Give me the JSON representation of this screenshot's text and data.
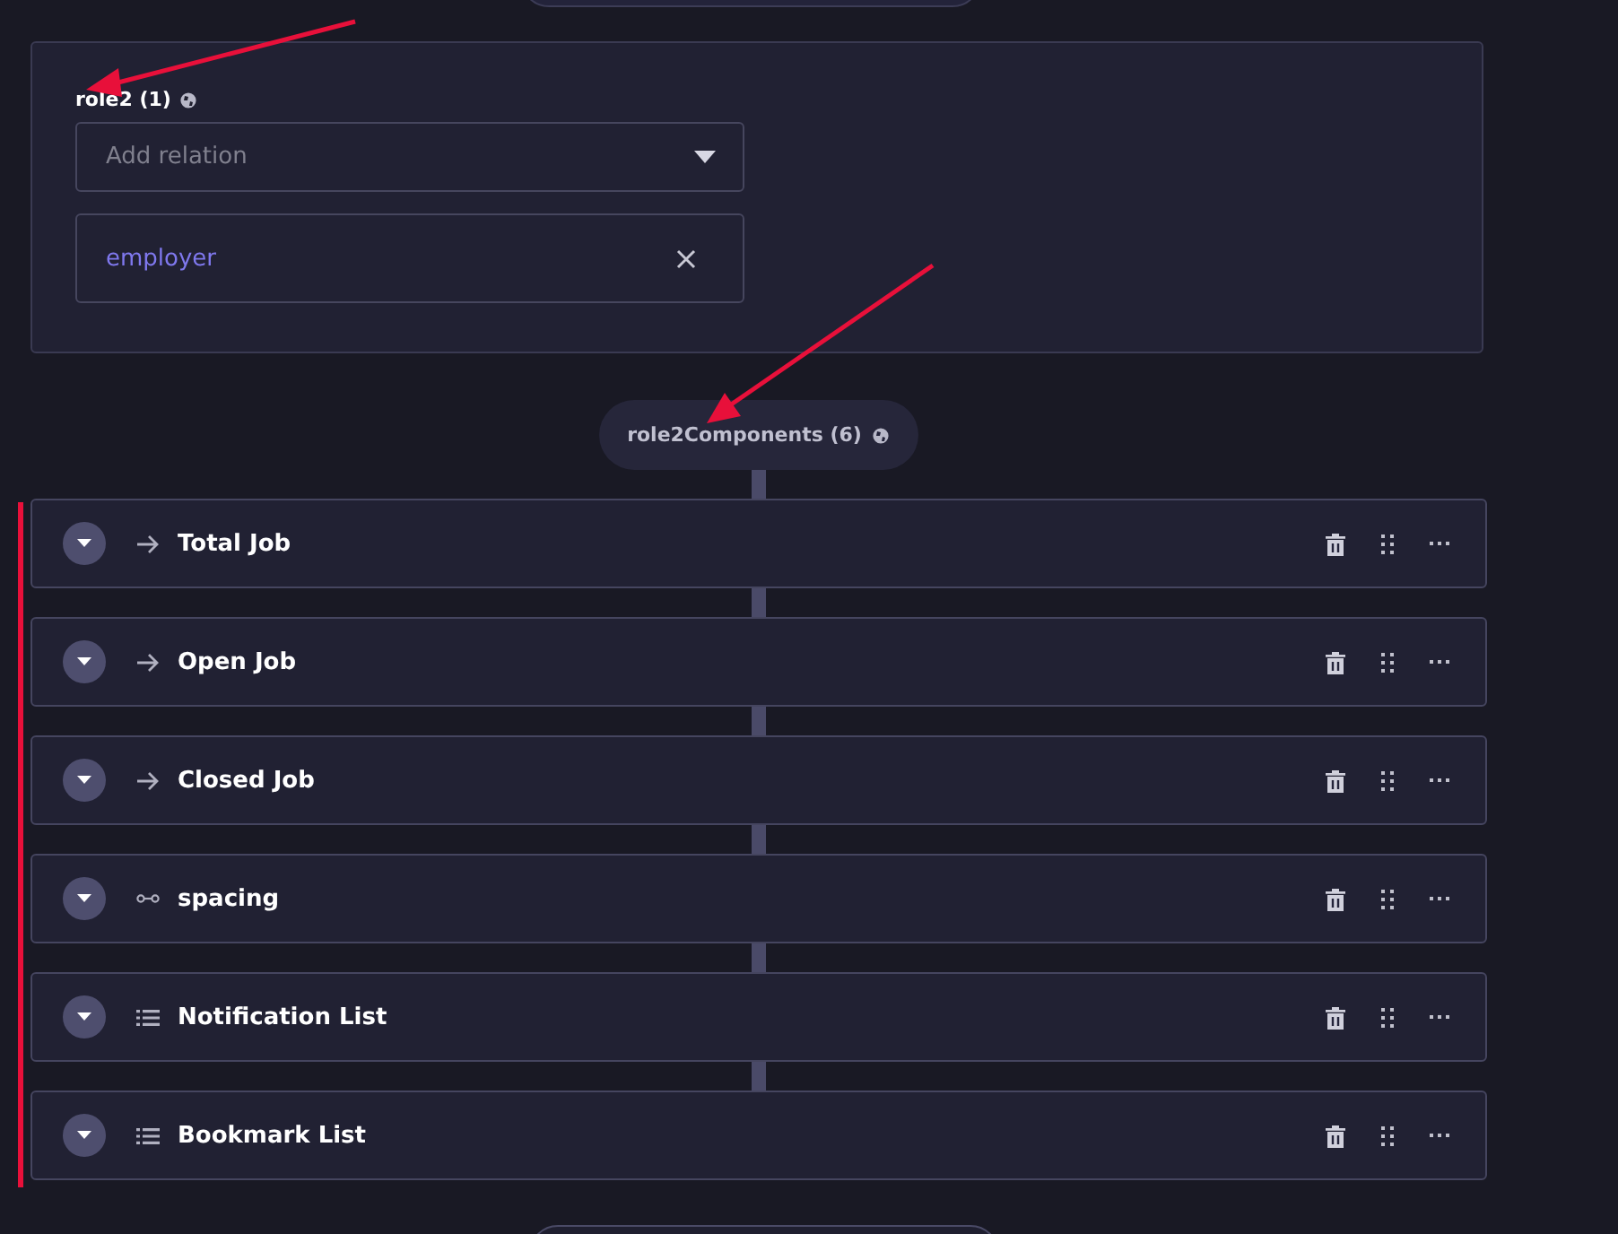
{
  "relation_card": {
    "label": "role2 (1)",
    "dropdown": {
      "placeholder": "Add relation"
    },
    "tags": [
      "employer"
    ]
  },
  "group": {
    "label": "role2Components (6)"
  },
  "components": [
    {
      "label": "Total Job",
      "kind": "arrow"
    },
    {
      "label": "Open Job",
      "kind": "arrow"
    },
    {
      "label": "Closed Job",
      "kind": "arrow"
    },
    {
      "label": "spacing",
      "kind": "spacing"
    },
    {
      "label": "Notification List",
      "kind": "list"
    },
    {
      "label": "Bookmark List",
      "kind": "list"
    }
  ]
}
